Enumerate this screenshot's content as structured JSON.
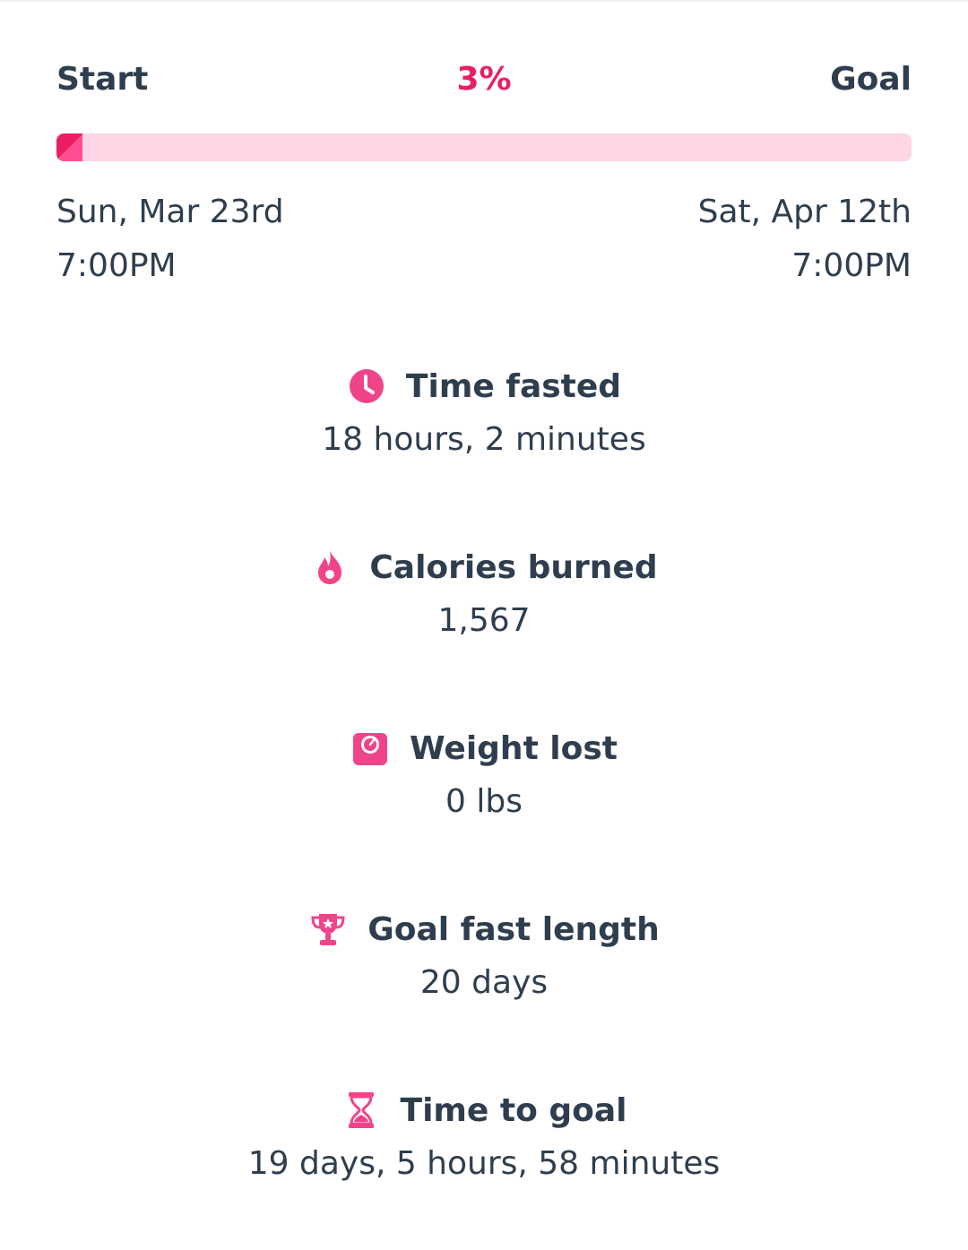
{
  "colors": {
    "accent": "#e91e63",
    "accent_light": "#ffd6e6",
    "text": "#2f3e4e"
  },
  "progress": {
    "start_label": "Start",
    "goal_label": "Goal",
    "percent_text": "3%",
    "percent_value": 0.03,
    "start_date": "Sun, Mar 23rd",
    "start_time": "7:00PM",
    "end_date": "Sat, Apr 12th",
    "end_time": "7:00PM"
  },
  "stats": [
    {
      "icon": "clock-icon",
      "title": "Time fasted",
      "value": "18 hours, 2 minutes"
    },
    {
      "icon": "flame-icon",
      "title": "Calories burned",
      "value": "1,567"
    },
    {
      "icon": "scale-icon",
      "title": "Weight lost",
      "value": "0 lbs"
    },
    {
      "icon": "trophy-icon",
      "title": "Goal fast length",
      "value": "20 days"
    },
    {
      "icon": "hourglass-icon",
      "title": "Time to goal",
      "value": "19 days, 5 hours, 58 minutes"
    }
  ]
}
